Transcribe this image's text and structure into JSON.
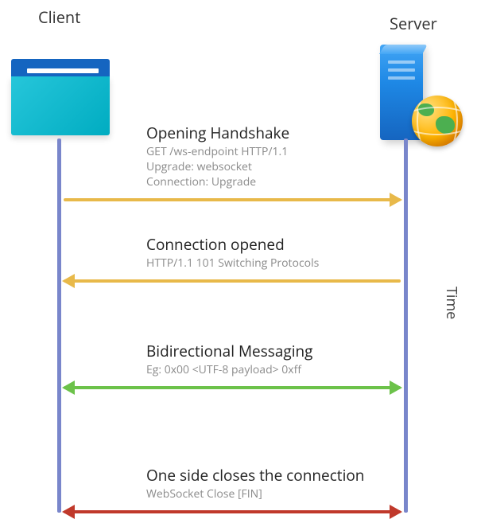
{
  "labels": {
    "client": "Client",
    "server": "Server",
    "time": "Time"
  },
  "entities": {
    "client_icon": "browser-window",
    "server_icon": "server-tower",
    "globe_icon": "globe"
  },
  "colors": {
    "lifeline": "#7986cb",
    "handshake_arrow": "#e8b94a",
    "messaging_arrow": "#6cc24a",
    "close_arrow": "#c0392b",
    "client_accent": "#00acc1",
    "server_accent": "#1e88e5"
  },
  "steps": [
    {
      "id": "opening-handshake",
      "title": "Opening Handshake",
      "details": [
        "GET /ws-endpoint HTTP/1.1",
        "Upgrade: websocket",
        "Connection: Upgrade"
      ],
      "direction": "client-to-server",
      "arrow_color": "handshake_arrow"
    },
    {
      "id": "connection-opened",
      "title": "Connection opened",
      "details": [
        "HTTP/1.1 101 Switching Protocols"
      ],
      "direction": "server-to-client",
      "arrow_color": "handshake_arrow"
    },
    {
      "id": "bidirectional-messaging",
      "title": "Bidirectional Messaging",
      "details": [
        "Eg: 0x00 <UTF-8 payload> 0xff"
      ],
      "direction": "both",
      "arrow_color": "messaging_arrow"
    },
    {
      "id": "close-connection",
      "title": "One side closes the connection",
      "details": [
        "WebSocket Close [FIN]"
      ],
      "direction": "both",
      "arrow_color": "close_arrow"
    }
  ]
}
